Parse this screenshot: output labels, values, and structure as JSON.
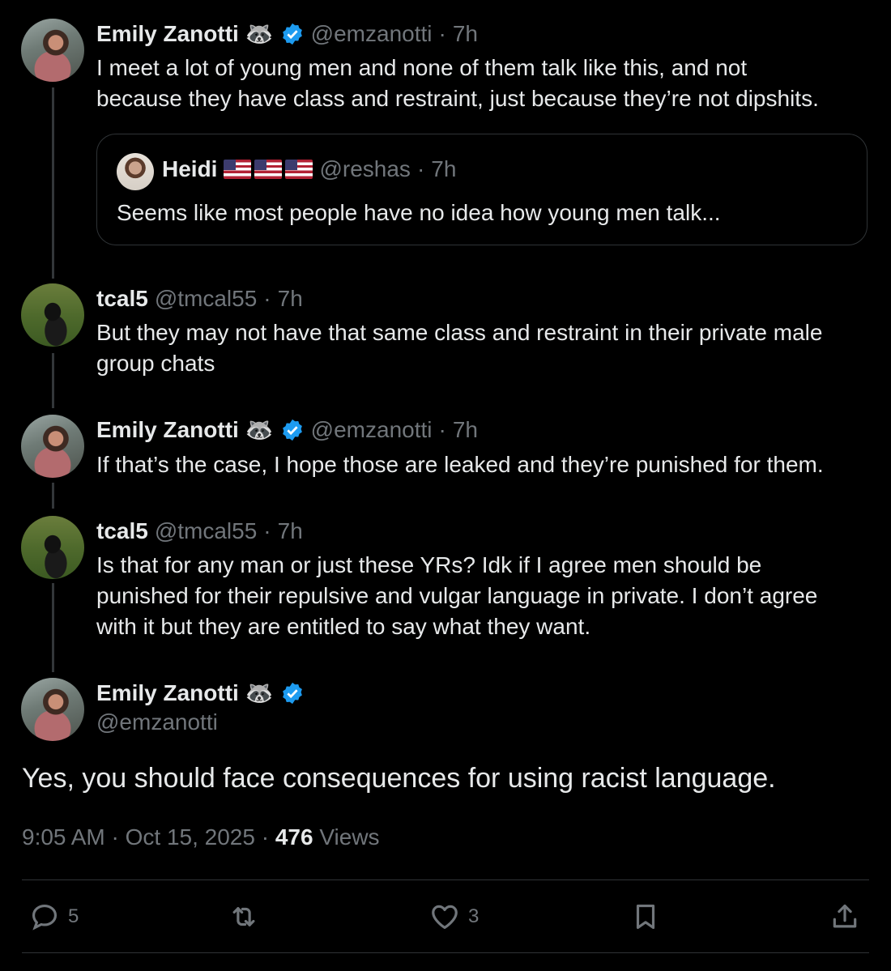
{
  "thread": [
    {
      "name": "Emily Zanotti",
      "badge_emoji": "🦝",
      "handle": "@emzanotti",
      "time": "7h",
      "text": [
        "I meet a lot of young men and none of them talk like this, and not",
        "because they have class and restraint, just because they’re not dipshits."
      ],
      "quote": {
        "name": "Heidi",
        "handle": "@reshas",
        "time": "7h",
        "text": "Seems like most people have no idea how young men talk..."
      }
    },
    {
      "name": "tcal5",
      "handle": "@tmcal55",
      "time": "7h",
      "text": [
        "But they may not have that same class and restraint in their private male",
        "group chats"
      ]
    },
    {
      "name": "Emily Zanotti",
      "badge_emoji": "🦝",
      "handle": "@emzanotti",
      "time": "7h",
      "text": [
        "If that’s the case, I hope those are leaked and they’re punished for them."
      ]
    },
    {
      "name": "tcal5",
      "handle": "@tmcal55",
      "time": "7h",
      "text": [
        "Is that for any man or just these YRs? Idk if I agree men should be",
        "punished for their repulsive and vulgar language in private. I don’t agree",
        "with it but they are entitled to say what they want."
      ]
    }
  ],
  "main_tweet": {
    "name": "Emily Zanotti",
    "badge_emoji": "🦝",
    "handle": "@emzanotti",
    "text": "Yes, you should face consequences for using racist language.",
    "time": "9:05 AM",
    "date": "Oct 15, 2025",
    "views_count": "476",
    "views_label": "Views"
  },
  "actions": {
    "replies": "5",
    "likes": "3"
  },
  "colors": {
    "background": "#000000",
    "text": "#e7e9ea",
    "secondary": "#71767b",
    "verified": "#1d9bf0",
    "border": "#2f3336"
  },
  "separator": "·"
}
